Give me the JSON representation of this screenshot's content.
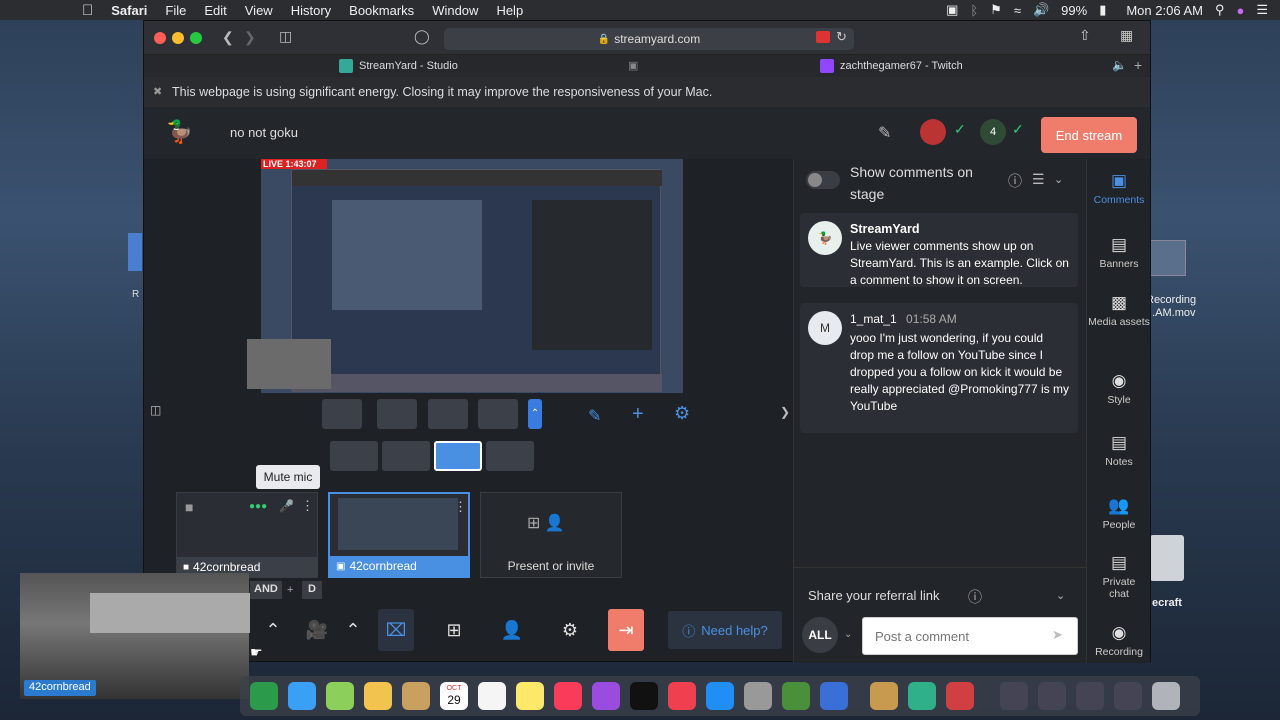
{
  "menubar": {
    "apple": "",
    "app": "Safari",
    "items": [
      "File",
      "Edit",
      "View",
      "History",
      "Bookmarks",
      "Window",
      "Help"
    ],
    "battery": "99%",
    "clock": "Mon 2:06 AM"
  },
  "browser": {
    "url": "streamyard.com",
    "tabs": [
      {
        "title": "StreamYard - Studio"
      },
      {
        "title": "zachthegamer67 - Twitch"
      }
    ],
    "energy_warning": "This webpage is using significant energy. Closing it may improve the responsiveness of your Mac."
  },
  "studio": {
    "broadcast_title": "no not goku",
    "end_stream": "End stream",
    "destination_badge": "4",
    "stage_live_label": "LIVE 1:43:07",
    "mute_tooltip": "Mute mic",
    "participants": [
      {
        "name": "42cornbread"
      },
      {
        "name": "42cornbread"
      }
    ],
    "present_or_invite": "Present or invite",
    "shortcut": {
      "key1": "AND",
      "plus": "+",
      "key2": "D"
    },
    "need_help": "Need help?",
    "webcam_label": "42cornbread"
  },
  "comments_panel": {
    "show_on_stage": "Show comments on stage",
    "comments": [
      {
        "author": "StreamYard",
        "time": "",
        "text": "Live viewer comments show up on StreamYard. This is an example. Click on a comment to show it on screen."
      },
      {
        "author": "1_mat_1",
        "time": "01:58 AM",
        "avatar_letter": "M",
        "text": "yooo I'm just wondering, if you could drop me a follow on YouTube since I dropped you a follow on kick it would be really appreciated @Promoking777 is my YouTube"
      }
    ],
    "referral": "Share your referral link",
    "filter": "ALL",
    "post_placeholder": "Post a comment"
  },
  "sidenav": [
    {
      "label": "Comments",
      "icon": "comment-icon"
    },
    {
      "label": "Banners",
      "icon": "banner-icon"
    },
    {
      "label": "Media assets",
      "icon": "media-icon"
    },
    {
      "label": "Style",
      "icon": "palette-icon"
    },
    {
      "label": "Notes",
      "icon": "notes-icon"
    },
    {
      "label": "People",
      "icon": "people-icon"
    },
    {
      "label": "Private chat",
      "icon": "chat-icon"
    },
    {
      "label": "Recording",
      "icon": "record-icon"
    }
  ],
  "desktop": {
    "recording_file": "Recording ...AM.mov",
    "folder": "ecraft",
    "left_label": "R"
  },
  "dock": {
    "calendar_month": "OCT",
    "calendar_day": "29"
  }
}
